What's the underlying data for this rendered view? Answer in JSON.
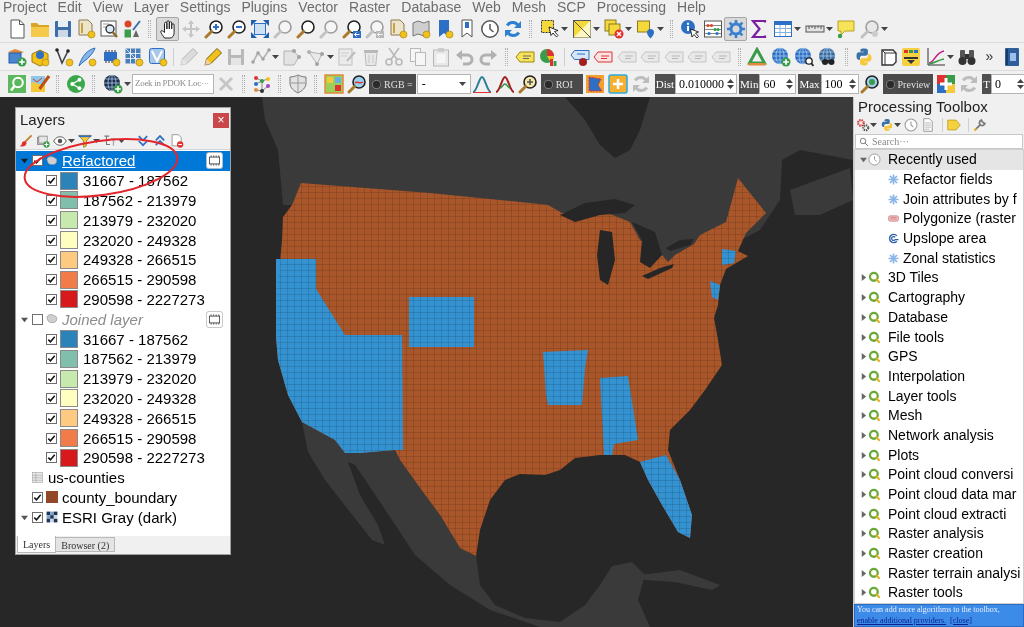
{
  "menu_bar": [
    "Project",
    "Edit",
    "View",
    "Layer",
    "Settings",
    "Plugins",
    "Vector",
    "Raster",
    "Database",
    "Web",
    "Mesh",
    "SCP",
    "Processing",
    "Help"
  ],
  "toolbars": [
    {
      "items": [
        {
          "kind": "button",
          "disabled": false,
          "pressed": false
        },
        {
          "kind": "button",
          "disabled": false,
          "pressed": false
        },
        {
          "kind": "button",
          "disabled": false,
          "pressed": false
        },
        {
          "kind": "button",
          "disabled": false,
          "pressed": false
        },
        {
          "kind": "button",
          "disabled": false,
          "pressed": false
        },
        {
          "kind": "button",
          "disabled": false,
          "pressed": false
        },
        {
          "kind": "grip"
        },
        {
          "kind": "button",
          "disabled": false,
          "pressed": true
        },
        {
          "kind": "button",
          "disabled": true,
          "pressed": false
        },
        {
          "kind": "button",
          "disabled": false,
          "pressed": false
        },
        {
          "kind": "button",
          "disabled": false,
          "pressed": false
        },
        {
          "kind": "button",
          "disabled": false,
          "pressed": false
        },
        {
          "kind": "button",
          "disabled": true,
          "pressed": false
        },
        {
          "kind": "button",
          "disabled": false,
          "pressed": false
        },
        {
          "kind": "button",
          "disabled": true,
          "pressed": false
        },
        {
          "kind": "button",
          "disabled": false,
          "pressed": false
        },
        {
          "kind": "button",
          "disabled": true,
          "pressed": false
        },
        {
          "kind": "button",
          "disabled": false,
          "pressed": false
        },
        {
          "kind": "button",
          "disabled": false,
          "pressed": false
        },
        {
          "kind": "button",
          "disabled": false,
          "pressed": false
        },
        {
          "kind": "button",
          "disabled": false,
          "pressed": false
        },
        {
          "kind": "button",
          "disabled": false,
          "pressed": false
        },
        {
          "kind": "button",
          "disabled": false,
          "pressed": false
        },
        {
          "kind": "grip"
        },
        {
          "kind": "menu_button",
          "disabled": false,
          "pressed": false
        },
        {
          "kind": "menu_button",
          "disabled": false,
          "pressed": false
        },
        {
          "kind": "menu_button",
          "disabled": false,
          "pressed": false
        },
        {
          "kind": "menu_button",
          "disabled": false,
          "pressed": false
        },
        {
          "kind": "grip"
        },
        {
          "kind": "button",
          "disabled": false,
          "pressed": false
        },
        {
          "kind": "button",
          "disabled": false,
          "pressed": false
        },
        {
          "kind": "button",
          "disabled": false,
          "pressed": true
        },
        {
          "kind": "button",
          "disabled": false,
          "pressed": false
        },
        {
          "kind": "menu_button",
          "disabled": false,
          "pressed": false
        },
        {
          "kind": "menu_button",
          "disabled": false,
          "pressed": false
        },
        {
          "kind": "button",
          "disabled": false,
          "pressed": false
        },
        {
          "kind": "menu_button",
          "disabled": true,
          "pressed": false
        }
      ]
    },
    {
      "items": [
        {
          "kind": "button",
          "disabled": false,
          "pressed": false
        },
        {
          "kind": "button",
          "disabled": false,
          "pressed": false
        },
        {
          "kind": "button",
          "disabled": false,
          "pressed": false
        },
        {
          "kind": "button",
          "disabled": false,
          "pressed": false
        },
        {
          "kind": "button",
          "disabled": false,
          "pressed": false
        },
        {
          "kind": "button",
          "disabled": false,
          "pressed": false
        },
        {
          "kind": "button",
          "disabled": false,
          "pressed": false
        },
        {
          "kind": "separator"
        },
        {
          "kind": "button",
          "disabled": true,
          "pressed": false
        },
        {
          "kind": "button",
          "disabled": false,
          "pressed": false
        },
        {
          "kind": "button",
          "disabled": true,
          "pressed": false
        },
        {
          "kind": "menu_button",
          "disabled": true,
          "pressed": false
        },
        {
          "kind": "button",
          "disabled": true,
          "pressed": false
        },
        {
          "kind": "menu_button",
          "disabled": true,
          "pressed": false
        },
        {
          "kind": "button",
          "disabled": true,
          "pressed": false
        },
        {
          "kind": "button",
          "disabled": true,
          "pressed": false
        },
        {
          "kind": "button",
          "disabled": true,
          "pressed": false
        },
        {
          "kind": "button",
          "disabled": true,
          "pressed": false
        },
        {
          "kind": "button",
          "disabled": true,
          "pressed": false
        },
        {
          "kind": "button",
          "disabled": true,
          "pressed": false
        },
        {
          "kind": "button",
          "disabled": true,
          "pressed": false
        },
        {
          "kind": "grip"
        },
        {
          "kind": "button",
          "disabled": false,
          "pressed": false
        },
        {
          "kind": "button",
          "disabled": false,
          "pressed": false
        },
        {
          "kind": "separator"
        },
        {
          "kind": "button",
          "disabled": false,
          "pressed": false
        },
        {
          "kind": "button",
          "disabled": false,
          "pressed": false
        },
        {
          "kind": "button",
          "disabled": true,
          "pressed": false
        },
        {
          "kind": "button",
          "disabled": true,
          "pressed": false
        },
        {
          "kind": "button",
          "disabled": true,
          "pressed": false
        },
        {
          "kind": "button",
          "disabled": true,
          "pressed": false
        },
        {
          "kind": "button",
          "disabled": true,
          "pressed": false
        },
        {
          "kind": "grip"
        },
        {
          "kind": "button",
          "disabled": false,
          "pressed": false
        },
        {
          "kind": "button",
          "disabled": false,
          "pressed": false
        },
        {
          "kind": "button",
          "disabled": false,
          "pressed": false
        },
        {
          "kind": "button",
          "disabled": false,
          "pressed": false
        },
        {
          "kind": "grip"
        },
        {
          "kind": "button",
          "disabled": false,
          "pressed": false
        },
        {
          "kind": "button",
          "disabled": false,
          "pressed": false
        },
        {
          "kind": "button",
          "disabled": false,
          "pressed": false
        },
        {
          "kind": "menu_button",
          "disabled": false,
          "pressed": false
        },
        {
          "kind": "button",
          "disabled": false,
          "pressed": false
        },
        {
          "kind": "overflow",
          "label": "»"
        },
        {
          "kind": "button",
          "disabled": false,
          "pressed": false
        }
      ]
    },
    {
      "items": [
        {
          "kind": "button",
          "disabled": false,
          "pressed": false
        },
        {
          "kind": "button",
          "disabled": false,
          "pressed": false
        },
        {
          "kind": "grip"
        },
        {
          "kind": "button",
          "disabled": false,
          "pressed": false
        },
        {
          "kind": "grip"
        },
        {
          "kind": "menu_button",
          "disabled": false,
          "pressed": false
        },
        {
          "kind": "search",
          "placeholder": "Zoek in PDOK Loc···"
        },
        {
          "kind": "button",
          "disabled": true,
          "pressed": false
        },
        {
          "kind": "grip"
        },
        {
          "kind": "button",
          "disabled": false,
          "pressed": false
        },
        {
          "kind": "grip"
        },
        {
          "kind": "button",
          "disabled": false,
          "pressed": false
        },
        {
          "kind": "grip"
        },
        {
          "kind": "button",
          "disabled": false,
          "pressed": false
        },
        {
          "kind": "button",
          "disabled": false,
          "pressed": false
        },
        {
          "kind": "toggle",
          "label": "RGB =",
          "checked": false
        },
        {
          "kind": "combo",
          "value": "-"
        },
        {
          "kind": "button",
          "disabled": false,
          "pressed": false
        },
        {
          "kind": "button",
          "disabled": false,
          "pressed": false
        },
        {
          "kind": "button",
          "disabled": false,
          "pressed": false
        },
        {
          "kind": "toggle",
          "label": "ROI",
          "checked": false
        },
        {
          "kind": "button",
          "disabled": false,
          "pressed": false
        },
        {
          "kind": "button",
          "disabled": false,
          "pressed": false
        },
        {
          "kind": "button",
          "disabled": true,
          "pressed": false
        },
        {
          "kind": "spinbox",
          "label": "Dist",
          "value": "0.010000"
        },
        {
          "kind": "spinbox",
          "label": "Min",
          "value": "60"
        },
        {
          "kind": "spinbox",
          "label": "Max",
          "value": "100"
        },
        {
          "kind": "button",
          "disabled": false,
          "pressed": false
        },
        {
          "kind": "toggle",
          "label": "Preview",
          "checked": false
        },
        {
          "kind": "button",
          "disabled": false,
          "pressed": false
        },
        {
          "kind": "button",
          "disabled": true,
          "pressed": false
        },
        {
          "kind": "spinbox",
          "label": "T",
          "value": "0"
        }
      ]
    }
  ],
  "layers_panel": {
    "title": "Layers",
    "close": "×",
    "tree": [
      {
        "kind": "vector",
        "name": "Refactored",
        "checked": true,
        "expanded": true,
        "selected": true,
        "temporary": true,
        "children": [
          {
            "label": "31667 - 187562",
            "checked": true,
            "color": "#2b83ba"
          },
          {
            "label": "187562 - 213979",
            "checked": true,
            "color": "#80bfac"
          },
          {
            "label": "213979 - 232020",
            "checked": true,
            "color": "#c7e9ad"
          },
          {
            "label": "232020 - 249328",
            "checked": true,
            "color": "#ffffbf"
          },
          {
            "label": "249328 - 266515",
            "checked": true,
            "color": "#fec980"
          },
          {
            "label": "266515 - 290598",
            "checked": true,
            "color": "#f17c4a"
          },
          {
            "label": "290598 - 2227273",
            "checked": true,
            "color": "#d7191c"
          }
        ]
      },
      {
        "kind": "vector",
        "name": "Joined layer",
        "checked": false,
        "expanded": true,
        "selected": false,
        "temporary": true,
        "children": [
          {
            "label": "31667 - 187562",
            "checked": true,
            "color": "#2b83ba"
          },
          {
            "label": "187562 - 213979",
            "checked": true,
            "color": "#80bfac"
          },
          {
            "label": "213979 - 232020",
            "checked": true,
            "color": "#c7e9ad"
          },
          {
            "label": "232020 - 249328",
            "checked": true,
            "color": "#ffffbf"
          },
          {
            "label": "249328 - 266515",
            "checked": true,
            "color": "#fec980"
          },
          {
            "label": "266515 - 290598",
            "checked": true,
            "color": "#f17c4a"
          },
          {
            "label": "290598 - 2227273",
            "checked": true,
            "color": "#d7191c"
          }
        ]
      },
      {
        "kind": "table",
        "name": "us-counties",
        "selected": false,
        "temporary": false
      },
      {
        "kind": "single_symbol",
        "name": "county_boundary",
        "checked": true,
        "selected": false,
        "temporary": false,
        "color": "#91492a"
      },
      {
        "kind": "raster",
        "name": "ESRI Gray (dark)",
        "checked": true,
        "expanded": true,
        "selected": false,
        "temporary": false
      }
    ],
    "tabs": [
      {
        "label": "Layers",
        "selected": true
      },
      {
        "label": "Browser (2)",
        "selected": false
      }
    ]
  },
  "processing_toolbox": {
    "title": "Processing Toolbox",
    "search": {
      "placeholder": "Search···"
    },
    "tree": [
      {
        "kind": "history",
        "label": "Recently used",
        "expanded": true,
        "selected": true,
        "children": [
          {
            "kind": "native",
            "label": "Refactor fields",
            "selected": false
          },
          {
            "kind": "native",
            "label": "Join attributes by f",
            "selected": false
          },
          {
            "kind": "gdal",
            "label": "Polygonize (raster",
            "selected": false
          },
          {
            "kind": "plugin",
            "label": "Upslope area",
            "selected": false
          },
          {
            "kind": "native",
            "label": "Zonal statistics",
            "selected": false
          }
        ]
      },
      {
        "kind": "provider",
        "label": "3D Tiles",
        "expanded": false,
        "selected": false
      },
      {
        "kind": "provider",
        "label": "Cartography",
        "expanded": false,
        "selected": false
      },
      {
        "kind": "provider",
        "label": "Database",
        "expanded": false,
        "selected": false
      },
      {
        "kind": "provider",
        "label": "File tools",
        "expanded": false,
        "selected": false
      },
      {
        "kind": "provider",
        "label": "GPS",
        "expanded": false,
        "selected": false
      },
      {
        "kind": "provider",
        "label": "Interpolation",
        "expanded": false,
        "selected": false
      },
      {
        "kind": "provider",
        "label": "Layer tools",
        "expanded": false,
        "selected": false
      },
      {
        "kind": "provider",
        "label": "Mesh",
        "expanded": false,
        "selected": false
      },
      {
        "kind": "provider",
        "label": "Network analysis",
        "expanded": false,
        "selected": false
      },
      {
        "kind": "provider",
        "label": "Plots",
        "expanded": false,
        "selected": false
      },
      {
        "kind": "provider",
        "label": "Point cloud conversi",
        "expanded": false,
        "selected": false
      },
      {
        "kind": "provider",
        "label": "Point cloud data mar",
        "expanded": false,
        "selected": false
      },
      {
        "kind": "provider",
        "label": "Point cloud extracti",
        "expanded": false,
        "selected": false
      },
      {
        "kind": "provider",
        "label": "Raster analysis",
        "expanded": false,
        "selected": false
      },
      {
        "kind": "provider",
        "label": "Raster creation",
        "expanded": false,
        "selected": false
      },
      {
        "kind": "provider",
        "label": "Raster terrain analysi",
        "expanded": false,
        "selected": false
      },
      {
        "kind": "provider",
        "label": "Raster tools",
        "expanded": false,
        "selected": false
      }
    ],
    "notice": {
      "text": "You can add more algorithms to the toolbox,",
      "links": [
        "enable additional providers.",
        "[close]"
      ]
    }
  }
}
